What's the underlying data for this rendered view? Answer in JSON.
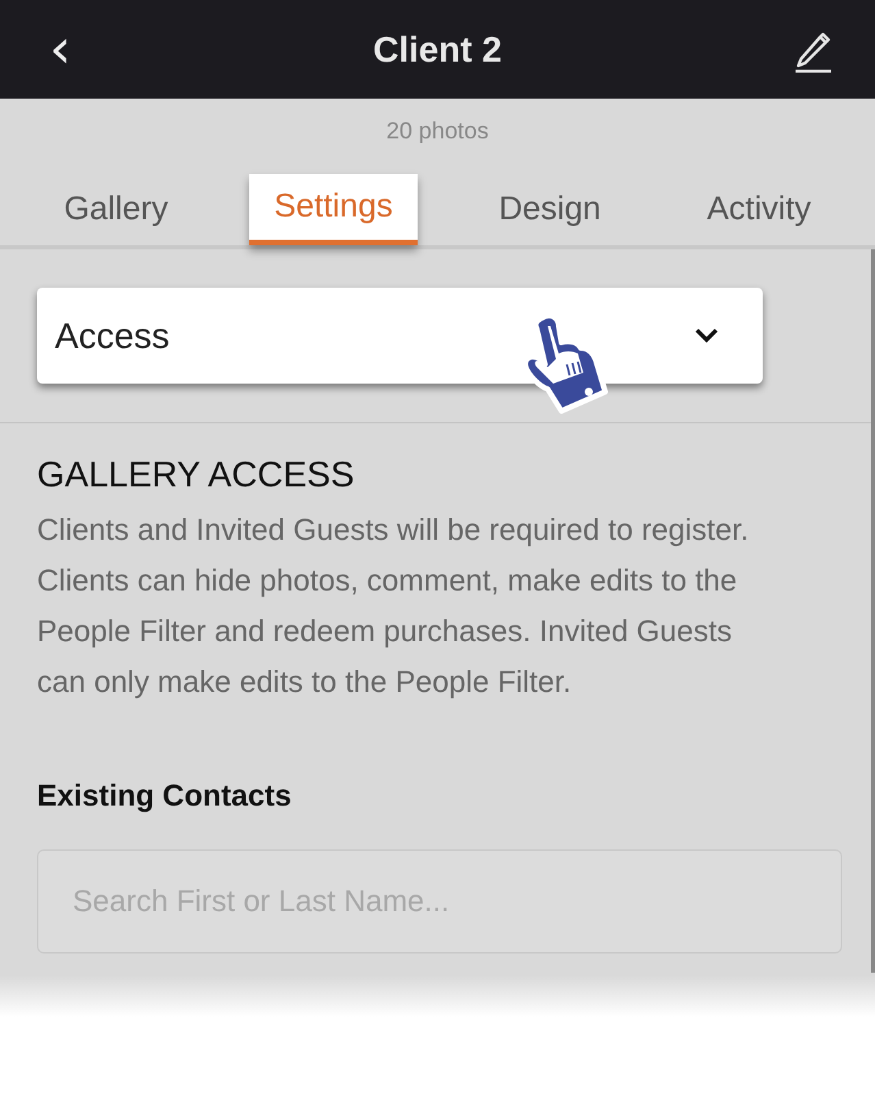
{
  "header": {
    "back": "‹",
    "title": "Client 2"
  },
  "subtitle": "20 photos",
  "tabs": [
    {
      "label": "Gallery",
      "selected": false
    },
    {
      "label": "Settings",
      "selected": true
    },
    {
      "label": "Design",
      "selected": false
    },
    {
      "label": "Activity",
      "selected": false
    }
  ],
  "dropdown": {
    "value": "Access"
  },
  "section": {
    "heading": "GALLERY ACCESS",
    "text": "Clients and Invited Guests will be required to register. Clients can hide photos, comment, make edits to the People Filter and redeem purchases. Invited Guests can only make edits to the People Filter."
  },
  "contacts": {
    "heading": "Existing Contacts",
    "search": {
      "placeholder": "Search First or Last Name..."
    }
  }
}
